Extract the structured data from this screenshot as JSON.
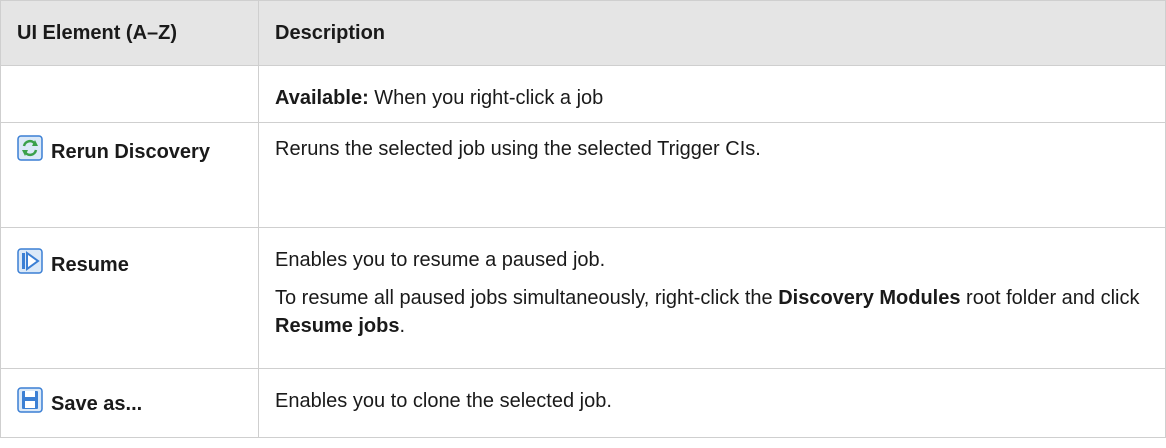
{
  "header": {
    "col1": "UI Element (A–Z)",
    "col2": "Description"
  },
  "rows": [
    {
      "element": "",
      "icon": "",
      "desc": {
        "bold": "Available:",
        "text": " When you right-click a job"
      }
    },
    {
      "element": "Rerun Discovery",
      "icon": "rerun-discovery-icon",
      "desc": {
        "text": "Reruns the selected job using the selected Trigger CIs."
      }
    },
    {
      "element": "Resume",
      "icon": "resume-icon",
      "desc": {
        "p1": "Enables you to resume a paused job.",
        "p2_a": "To resume all paused jobs simultaneously, right-click the ",
        "p2_b": "Discovery Modules",
        "p2_c": " root folder and click ",
        "p2_d": "Resume jobs",
        "p2_e": "."
      }
    },
    {
      "element": "Save as...",
      "icon": "save-icon",
      "desc": {
        "text": "Enables you to clone the selected job."
      }
    }
  ],
  "colors": {
    "header_bg": "#e5e5e5",
    "border": "#cfcfcf",
    "icon_blue": "#3b7fd4",
    "icon_green": "#3aa04a"
  }
}
